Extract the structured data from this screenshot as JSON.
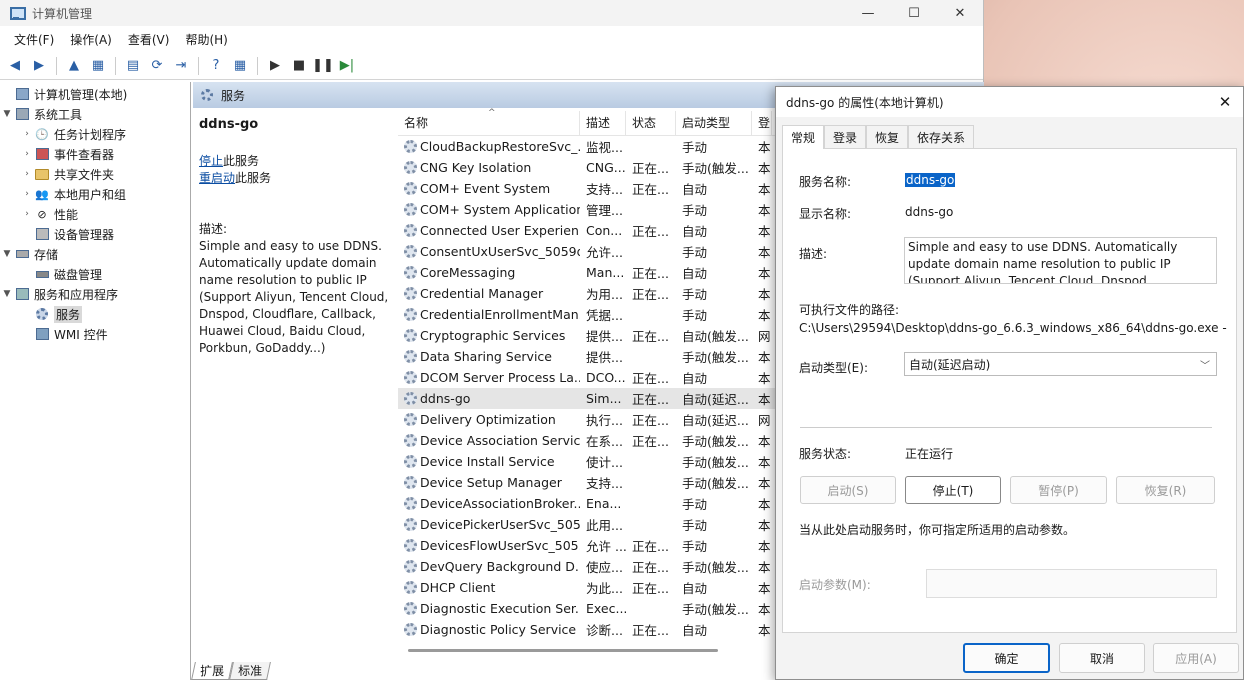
{
  "window": {
    "title": "计算机管理",
    "minimize": "—",
    "maximize": "☐",
    "close": "✕"
  },
  "menu": [
    "文件(F)",
    "操作(A)",
    "查看(V)",
    "帮助(H)"
  ],
  "toolbar": [
    "◀",
    "▶",
    "▲",
    "▦",
    "▤",
    "⟳",
    "⇥",
    "?",
    "▦",
    "▶",
    "■",
    "❚❚",
    "▶|"
  ],
  "tree": {
    "root": "计算机管理(本地)",
    "system_tools": "系统工具",
    "task_scheduler": "任务计划程序",
    "event_viewer": "事件查看器",
    "shared_folders": "共享文件夹",
    "local_users": "本地用户和组",
    "performance": "性能",
    "device_manager": "设备管理器",
    "storage": "存储",
    "disk_management": "磁盘管理",
    "services_apps": "服务和应用程序",
    "services": "服务",
    "wmi": "WMI 控件"
  },
  "services_panel": {
    "header": "服务",
    "selected_name": "ddns-go",
    "stop_link": "停止",
    "stop_suffix": "此服务",
    "restart_link": "重启动",
    "restart_suffix": "此服务",
    "desc_label": "描述:",
    "description": "Simple and easy to use DDNS. Automatically update domain name resolution to public IP (Support Aliyun, Tencent Cloud, Dnspod, Cloudflare, Callback, Huawei Cloud, Baidu Cloud, Porkbun, GoDaddy...)"
  },
  "columns": [
    "名称",
    "描述",
    "状态",
    "启动类型",
    "登"
  ],
  "sort_indicator": "^",
  "rows": [
    [
      "CloudBackupRestoreSvc_...",
      "监视...",
      "",
      "手动",
      "本"
    ],
    [
      "CNG Key Isolation",
      "CNG...",
      "正在...",
      "手动(触发...",
      "本"
    ],
    [
      "COM+ Event System",
      "支持...",
      "正在...",
      "自动",
      "本"
    ],
    [
      "COM+ System Application",
      "管理...",
      "",
      "手动",
      "本"
    ],
    [
      "Connected User Experien...",
      "Con...",
      "正在...",
      "自动",
      "本"
    ],
    [
      "ConsentUxUserSvc_5059d",
      "允许...",
      "",
      "手动",
      "本"
    ],
    [
      "CoreMessaging",
      "Man...",
      "正在...",
      "自动",
      "本"
    ],
    [
      "Credential Manager",
      "为用...",
      "正在...",
      "手动",
      "本"
    ],
    [
      "CredentialEnrollmentMan...",
      "凭据...",
      "",
      "手动",
      "本"
    ],
    [
      "Cryptographic Services",
      "提供...",
      "正在...",
      "自动(触发...",
      "网"
    ],
    [
      "Data Sharing Service",
      "提供...",
      "",
      "手动(触发...",
      "本"
    ],
    [
      "DCOM Server Process La...",
      "DCO...",
      "正在...",
      "自动",
      "本"
    ],
    [
      "ddns-go",
      "Sim...",
      "正在...",
      "自动(延迟...",
      "本"
    ],
    [
      "Delivery Optimization",
      "执行...",
      "正在...",
      "自动(延迟...",
      "网"
    ],
    [
      "Device Association Service",
      "在系...",
      "正在...",
      "手动(触发...",
      "本"
    ],
    [
      "Device Install Service",
      "使计...",
      "",
      "手动(触发...",
      "本"
    ],
    [
      "Device Setup Manager",
      "支持...",
      "",
      "手动(触发...",
      "本"
    ],
    [
      "DeviceAssociationBroker...",
      "Ena...",
      "",
      "手动",
      "本"
    ],
    [
      "DevicePickerUserSvc_505...",
      "此用...",
      "",
      "手动",
      "本"
    ],
    [
      "DevicesFlowUserSvc_505...",
      "允许 ...",
      "正在...",
      "手动",
      "本"
    ],
    [
      "DevQuery Background D...",
      "使应...",
      "正在...",
      "手动(触发...",
      "本"
    ],
    [
      "DHCP Client",
      "为此...",
      "正在...",
      "自动",
      "本"
    ],
    [
      "Diagnostic Execution Ser...",
      "Exec...",
      "",
      "手动(触发...",
      "本"
    ],
    [
      "Diagnostic Policy Service",
      "诊断...",
      "正在...",
      "自动",
      "本"
    ]
  ],
  "selected_row": 12,
  "bottom_tabs": [
    "扩展",
    "标准"
  ],
  "dialog": {
    "title": "ddns-go 的属性(本地计算机)",
    "close": "✕",
    "tabs": [
      "常规",
      "登录",
      "恢复",
      "依存关系"
    ],
    "service_name_label": "服务名称:",
    "service_name": "ddns-go",
    "display_name_label": "显示名称:",
    "display_name": "ddns-go",
    "desc_label": "描述:",
    "description": "Simple and easy to use DDNS. Automatically update domain name resolution to public IP (Support Aliyun, Tencent Cloud, Dnspod,",
    "path_label": "可执行文件的路径:",
    "path": "C:\\Users\\29594\\Desktop\\ddns-go_6.6.3_windows_x86_64\\ddns-go.exe -",
    "startup_label": "启动类型(E):",
    "startup_value": "自动(延迟启动)",
    "status_label": "服务状态:",
    "status_value": "正在运行",
    "btn_start": "启动(S)",
    "btn_stop": "停止(T)",
    "btn_pause": "暂停(P)",
    "btn_resume": "恢复(R)",
    "hint": "当从此处启动服务时，你可指定所适用的启动参数。",
    "param_label": "启动参数(M):",
    "ok": "确定",
    "cancel": "取消",
    "apply": "应用(A)"
  }
}
